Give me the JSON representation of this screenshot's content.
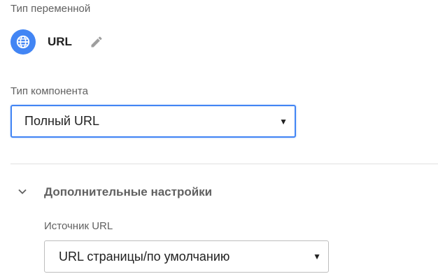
{
  "variable": {
    "type_label": "Тип переменной",
    "name": "URL",
    "icon": "globe-icon",
    "icon_color": "#4285f4",
    "edit_icon": "pencil-icon"
  },
  "component": {
    "label": "Тип компонента",
    "selected": "Полный URL",
    "accent": "#4285f4"
  },
  "advanced": {
    "title": "Дополнительные настройки",
    "expanded": true,
    "source_label": "Источник URL",
    "source_selected": "URL страницы/по умолчанию"
  },
  "dropdown_arrow": "▼"
}
